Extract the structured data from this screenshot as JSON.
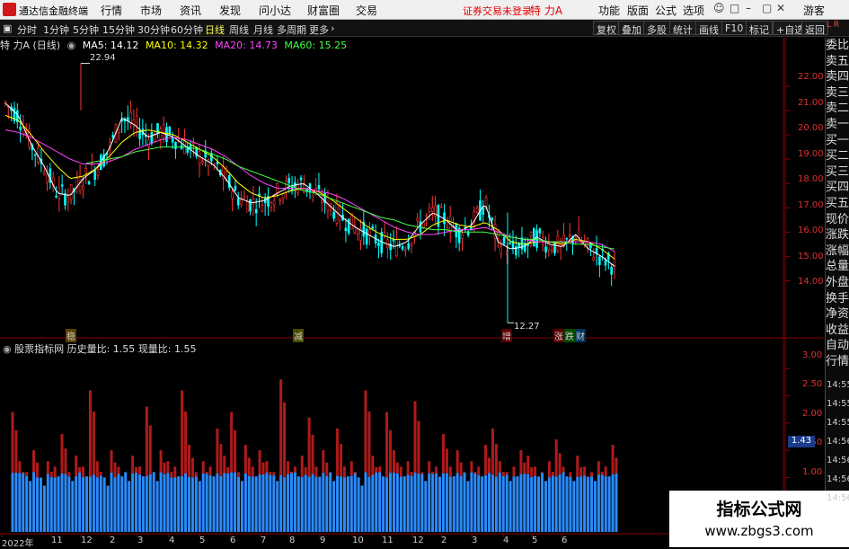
{
  "app": {
    "name": "通达信金融终端"
  },
  "menu": [
    "行情",
    "市场",
    "资讯",
    "发现",
    "问小达",
    "财富圈",
    "交易"
  ],
  "login_status": "证券交易未登录",
  "stock_name": "特 力A",
  "right_menu": [
    "功能",
    "版面",
    "公式",
    "选项"
  ],
  "user": "游客",
  "periods": [
    "分时",
    "1分钟",
    "5分钟",
    "15分钟",
    "30分钟",
    "60分钟",
    "日线",
    "周线",
    "月线",
    "多周期",
    "更多"
  ],
  "active_period": "日线",
  "right_buttons": [
    "复权",
    "叠加",
    "多股",
    "统计",
    "画线",
    "F10",
    "标记",
    "+自选",
    "返回"
  ],
  "chart_title": "特 力A (日线)",
  "ma": [
    {
      "label": "MA5: 14.12",
      "color": "#ffffff"
    },
    {
      "label": "MA10: 14.32",
      "color": "#ffff00"
    },
    {
      "label": "MA20: 14.73",
      "color": "#ff44ff"
    },
    {
      "label": "MA60: 15.25",
      "color": "#44ff44"
    }
  ],
  "price_axis": [
    "22.00",
    "21.00",
    "20.00",
    "19.00",
    "18.00",
    "17.00",
    "16.00",
    "15.00",
    "14.00"
  ],
  "high_label": "22.94",
  "low_label": "12.27",
  "events": [
    {
      "text": "稳",
      "color": "#ffcc00"
    },
    {
      "text": "减",
      "color": "#ffff00"
    },
    {
      "text": "增",
      "color": "#ff5555"
    },
    {
      "text": "涨",
      "color": "#ff5555"
    },
    {
      "text": "跌",
      "color": "#55ff55"
    },
    {
      "text": "财",
      "color": "#55aaff"
    }
  ],
  "volume_indicator": {
    "name": "股票指标网",
    "hist_label": "历史量比: 1.55",
    "now_label": "现量比: 1.55"
  },
  "volume_axis": [
    "3.00",
    "2.50",
    "2.00",
    "1.50",
    "1.00"
  ],
  "current_volume": "1.43",
  "time_labels": [
    "14:55",
    "14:55",
    "14:55",
    "14:56",
    "14:56",
    "14:56",
    "14:56"
  ],
  "x_labels": [
    "2022年",
    "11",
    "12",
    "2",
    "3",
    "4",
    "5",
    "6",
    "7",
    "8",
    "9",
    "10",
    "11",
    "12",
    "2",
    "3",
    "4",
    "5",
    "6"
  ],
  "side_items": [
    "委比",
    "卖五",
    "卖四",
    "卖三",
    "卖二",
    "卖一",
    "买一",
    "买二",
    "买三",
    "买四",
    "买五",
    "现价",
    "涨跌",
    "涨幅",
    "总量",
    "外盘",
    "换手",
    "净资",
    "收益",
    "自动",
    "行情"
  ],
  "side_top": "L",
  "side_top2": "R",
  "watermark": {
    "title": "指标公式网",
    "url": "www.zbgs3.com"
  },
  "colors": {
    "up": "#ff3333",
    "down": "#00ffff",
    "vol_red": "#b01a1a",
    "vol_blue": "#2a8bff",
    "axis": "#8b0000"
  },
  "chart_data": {
    "type": "candlestick",
    "title": "特 力A (日线)",
    "price_ylim": [
      11.8,
      23.4
    ],
    "price_ticks": [
      22,
      21,
      20,
      19,
      18,
      17,
      16,
      15,
      14
    ],
    "ma_lines": [
      {
        "name": "MA5",
        "values": [
          21.3,
          20.8,
          19.6,
          18.7,
          17.6,
          17.5,
          18.2,
          18.6,
          19.4,
          20.7,
          20.4,
          19.9,
          20.1,
          19.9,
          19.5,
          19.1,
          18.8,
          18.2,
          17.4,
          17.2,
          17.3,
          17.6,
          17.9,
          18.0,
          17.6,
          17.1,
          16.6,
          16.2,
          15.9,
          15.6,
          15.4,
          15.6,
          16.3,
          16.8,
          16.5,
          16.0,
          16.3,
          17.2,
          15.6,
          15.3,
          15.4,
          15.8,
          15.5,
          15.4,
          15.9,
          15.3,
          15.0,
          14.6
        ]
      },
      {
        "name": "MA10",
        "values": [
          20.8,
          20.6,
          20.0,
          19.3,
          18.7,
          18.2,
          18.3,
          18.6,
          19.1,
          19.7,
          20.1,
          20.2,
          20.1,
          20.0,
          19.7,
          19.4,
          19.1,
          18.6,
          18.0,
          17.6,
          17.4,
          17.5,
          17.7,
          17.8,
          17.7,
          17.4,
          17.0,
          16.6,
          16.2,
          15.9,
          15.7,
          15.7,
          15.9,
          16.3,
          16.5,
          16.3,
          16.2,
          16.4,
          16.1,
          15.6,
          15.5,
          15.6,
          15.6,
          15.5,
          15.7,
          15.6,
          15.3,
          14.9
        ]
      },
      {
        "name": "MA20",
        "values": [
          20.2,
          20.1,
          19.9,
          19.6,
          19.3,
          19.0,
          18.8,
          18.8,
          18.9,
          19.1,
          19.4,
          19.6,
          19.8,
          19.9,
          19.8,
          19.6,
          19.4,
          19.1,
          18.7,
          18.3,
          18.0,
          17.8,
          17.8,
          17.8,
          17.7,
          17.6,
          17.4,
          17.1,
          16.8,
          16.5,
          16.2,
          16.0,
          15.9,
          15.9,
          16.0,
          16.1,
          16.1,
          16.2,
          16.0,
          15.8,
          15.7,
          15.6,
          15.6,
          15.6,
          15.6,
          15.6,
          15.5,
          15.2
        ]
      },
      {
        "name": "MA60",
        "values": [
          null,
          null,
          null,
          null,
          null,
          null,
          18.8,
          18.9,
          19.0,
          19.1,
          19.3,
          19.4,
          19.5,
          19.5,
          19.5,
          19.4,
          19.2,
          19.0,
          18.7,
          18.5,
          18.3,
          18.1,
          17.9,
          17.7,
          17.6,
          17.4,
          17.2,
          17.0,
          16.8,
          16.6,
          16.5,
          16.3,
          16.2,
          16.1,
          16.1,
          16.0,
          16.0,
          16.0,
          15.9,
          15.8,
          15.7,
          15.7,
          15.6,
          15.6,
          15.5,
          15.5,
          15.4,
          15.3
        ]
      }
    ],
    "high": 22.94,
    "low": 12.27,
    "volume_ratio_ylim": [
      0,
      3.3
    ],
    "volume_ticks": [
      3.0,
      2.5,
      2.0,
      1.5,
      1.0
    ],
    "volume_ratio": [
      2.2,
      1.3,
      1.1,
      1.5,
      1.0,
      1.3,
      1.2,
      1.8,
      1.1,
      1.4,
      1.2,
      2.6,
      1.3,
      1.0,
      1.5,
      1.2,
      1.1,
      1.4,
      1.2,
      2.3,
      1.1,
      1.5,
      1.3,
      1.2,
      2.6,
      1.6,
      1.1,
      1.3,
      1.2,
      1.9,
      1.4,
      2.2,
      1.1,
      1.6,
      1.2,
      1.5,
      1.3,
      1.1,
      2.8,
      1.3,
      1.2,
      1.4,
      2.1,
      1.2,
      1.5,
      1.1,
      1.9,
      1.2,
      1.3,
      1.0,
      2.6,
      1.4,
      1.2,
      2.2,
      1.5,
      1.2,
      1.3,
      2.4,
      1.1,
      1.3,
      1.2,
      1.8,
      1.2,
      1.5,
      1.1,
      1.3,
      1.2,
      1.6,
      1.9,
      1.3,
      1.1,
      1.2,
      1.5,
      1.4,
      1.2,
      1.1,
      1.3,
      1.7,
      1.2,
      1.1,
      1.4,
      1.2,
      1.1,
      1.3,
      1.2,
      1.6
    ]
  }
}
